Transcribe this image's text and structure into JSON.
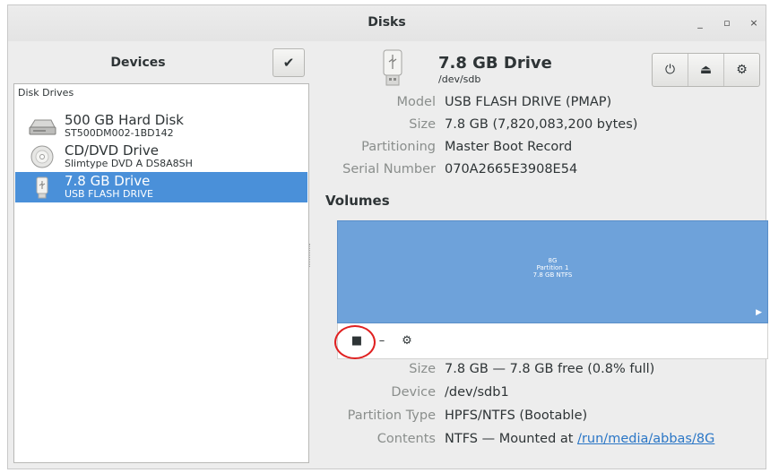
{
  "window": {
    "title": "Disks",
    "minimize_glyph": "_",
    "maximize_glyph": "▫",
    "close_glyph": "×"
  },
  "sidebar": {
    "header": "Devices",
    "check_icon": "checkmark-icon",
    "group_label": "Disk Drives",
    "devices": [
      {
        "name": "500 GB Hard Disk",
        "sub": "ST500DM002-1BD142",
        "icon": "hard-disk-icon",
        "selected": false
      },
      {
        "name": "CD/DVD Drive",
        "sub": "Slimtype DVD A  DS8A8SH",
        "icon": "optical-disc-icon",
        "selected": false
      },
      {
        "name": "7.8 GB Drive",
        "sub": "USB FLASH DRIVE",
        "icon": "usb-drive-icon",
        "selected": true
      }
    ]
  },
  "drive": {
    "title": "7.8 GB Drive",
    "device_path": "/dev/sdb",
    "buttons": [
      {
        "name": "power-off-icon",
        "glyph": "⏻"
      },
      {
        "name": "eject-icon",
        "glyph": "⏏"
      },
      {
        "name": "gear-icon",
        "glyph": "⚙"
      }
    ],
    "properties": [
      {
        "label": "Model",
        "value": "USB FLASH DRIVE (PMAP)"
      },
      {
        "label": "Size",
        "value": "7.8 GB (7,820,083,200 bytes)"
      },
      {
        "label": "Partitioning",
        "value": "Master Boot Record"
      },
      {
        "label": "Serial Number",
        "value": "070A2665E3908E54"
      }
    ]
  },
  "volumes": {
    "label": "Volumes",
    "partition": {
      "name": "8G",
      "index_label": "Partition 1",
      "size_fs": "7.8 GB NTFS"
    },
    "toolbar": {
      "stop_glyph": "■",
      "minus_glyph": "–",
      "gears_glyph": "⚙"
    },
    "details": [
      {
        "label": "Size",
        "value": "7.8 GB — 7.8 GB free (0.8% full)"
      },
      {
        "label": "Device",
        "value": "/dev/sdb1"
      },
      {
        "label": "Partition Type",
        "value": "HPFS/NTFS (Bootable)"
      },
      {
        "label": "Contents",
        "value": "NTFS — Mounted at ",
        "link": "/run/media/abbas/8G"
      }
    ]
  },
  "colors": {
    "selection": "#4a90d9",
    "volume_fill": "#6ea2da",
    "annotation_circle": "#e02020"
  }
}
